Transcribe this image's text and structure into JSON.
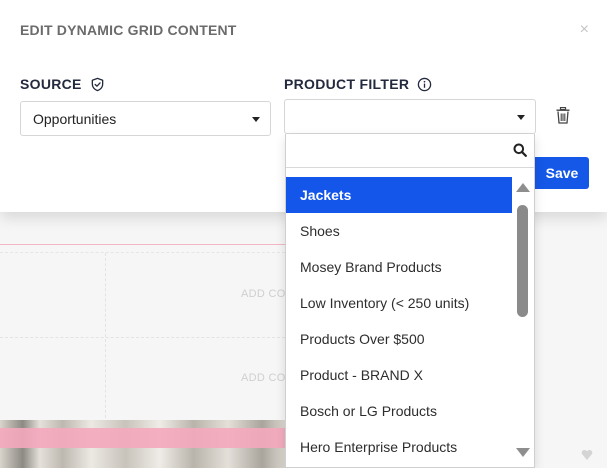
{
  "modal": {
    "title": "EDIT DYNAMIC GRID CONTENT",
    "close_glyph": "×",
    "close_icon": "close-icon"
  },
  "source": {
    "label": "SOURCE",
    "icon": "shield-check-icon",
    "selected": "Opportunities"
  },
  "product_filter": {
    "label": "PRODUCT FILTER",
    "icon": "info-icon",
    "selected": "",
    "delete_icon": "trash-icon",
    "search_value": "",
    "search_icon": "search-icon",
    "options": [
      "Jackets",
      "Shoes",
      "Mosey Brand Products",
      "Low Inventory (< 250 units)",
      "Products Over $500",
      "Product - BRAND X",
      "Bosch or LG Products",
      "Hero Enterprise Products"
    ],
    "highlighted_index": 0
  },
  "save_label": "Save",
  "background": {
    "add_label_1": "ADD CO",
    "add_label_2": "ADD CO"
  },
  "colors": {
    "primary": "#1558e8",
    "highlight": "#1456ea",
    "label": "#232a3d",
    "title": "#6b6b6b",
    "pink": "#f4a9bd"
  }
}
